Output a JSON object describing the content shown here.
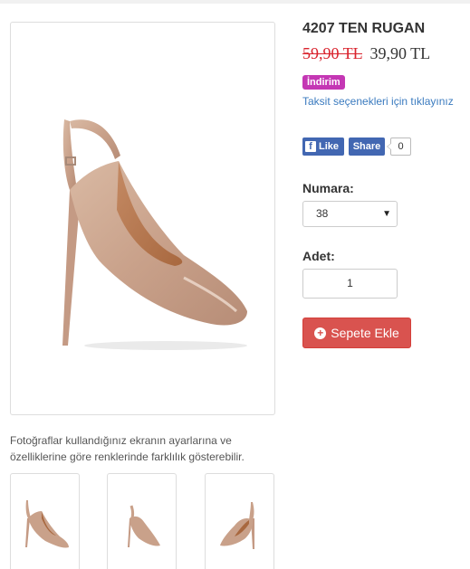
{
  "product": {
    "title": "4207 TEN RUGAN",
    "old_price": "59,90 TL",
    "new_price": "39,90 TL",
    "badge": "İndirim",
    "installment_link": "Taksit seçenekleri için tıklayınız",
    "disclaimer": "Fotoğraflar kullandığınız ekranın ayarlarına ve özelliklerine göre renklerinde farklılık gösterebilir."
  },
  "social": {
    "like_label": "Like",
    "share_label": "Share",
    "share_count": "0",
    "facebook_icon": "facebook-f-icon"
  },
  "options": {
    "size_label": "Numara:",
    "size_value": "38",
    "quantity_label": "Adet:",
    "quantity_value": "1"
  },
  "cart": {
    "button_label": "Sepete Ekle",
    "button_icon": "plus-circle-icon"
  },
  "colors": {
    "title": "#333333",
    "old_price": "#d9232d",
    "badge": "#c437b4",
    "link": "#3b7bbf",
    "facebook": "#4267b2",
    "cart_button": "#d9534f"
  }
}
